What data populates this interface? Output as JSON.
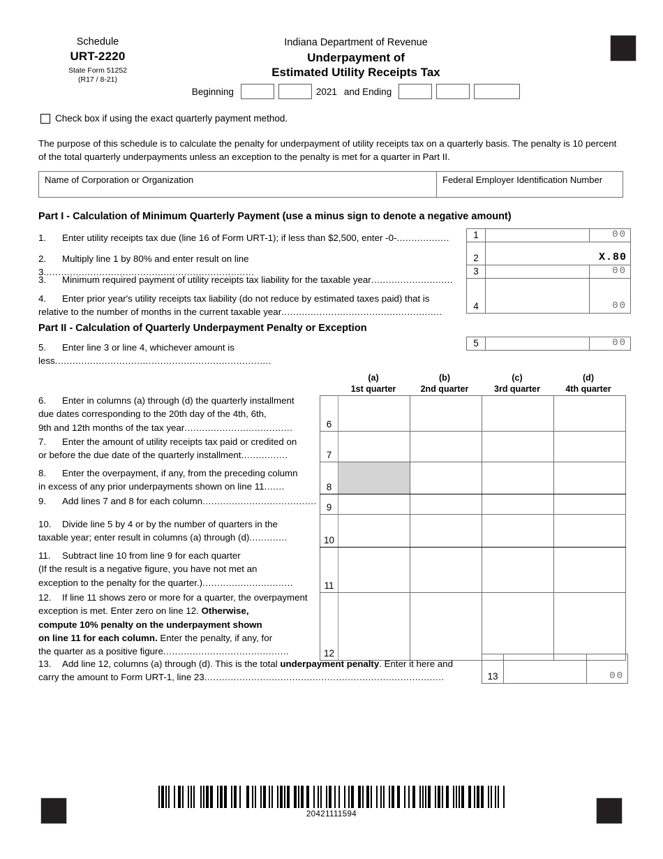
{
  "header": {
    "schedule_label": "Schedule",
    "form_number": "URT-2220",
    "state_form": "State Form 51252",
    "revision": "(R17 / 8-21)",
    "agency": "Indiana Department of Revenue",
    "title_line1": "Underpayment of",
    "title_line2": "Estimated Utility Receipts Tax"
  },
  "period": {
    "beginning_label": "Beginning",
    "year": "2021",
    "ending_label": "and Ending",
    "beginning_month": "",
    "beginning_day": "",
    "ending_month": "",
    "ending_day": "",
    "ending_year": ""
  },
  "exact_method": {
    "label": "Check box if using the exact quarterly payment method.",
    "checked": false
  },
  "purpose": "The purpose of this schedule is to calculate the penalty for underpayment of utility receipts tax on a quarterly basis. The penalty is 10 percent of the total quarterly underpayments unless an exception to the penalty is met for a quarter in Part II.",
  "taxpayer": {
    "name_label": "Name of Corporation or Organization",
    "name_value": "",
    "fein_label": "Federal Employer Identification Number",
    "fein_value": ""
  },
  "part1": {
    "heading": "Part I - Calculation of Minimum Quarterly Payment (use a minus sign to denote a negative amount)",
    "lines": [
      {
        "no": "1.",
        "box_no": "1",
        "text": "Enter utility receipts tax due (line 16 of Form URT-1); if less than $2,500, enter -0-",
        "leader": "..................",
        "value": "",
        "cents": "00"
      },
      {
        "no": "2.",
        "box_no": "2",
        "text": "Multiply line 1 by 80% and enter result on line 3",
        "leader": "........................................................................",
        "value": "",
        "cents": "X.80"
      },
      {
        "no": "3.",
        "box_no": "3",
        "text": "Minimum required payment of utility receipts tax liability for the taxable year",
        "leader": "............................",
        "value": "",
        "cents": "00"
      },
      {
        "no": "4.",
        "box_no": "4",
        "text_line1": "Enter prior year's utility receipts tax liability (do not reduce by estimated taxes paid) that is",
        "text_line2": "relative to the number of months in the current taxable year",
        "leader": ".......................................................",
        "value": "",
        "cents": "00"
      }
    ]
  },
  "part2": {
    "heading": "Part II - Calculation of Quarterly Underpayment Penalty or Exception",
    "line5": {
      "no": "5.",
      "box_no": "5",
      "text": "Enter line 3 or line 4, whichever amount is less",
      "leader": "..........................................................................",
      "value": "",
      "cents": "00"
    },
    "column_headers": [
      {
        "letter": "(a)",
        "label": "1st quarter"
      },
      {
        "letter": "(b)",
        "label": "2nd quarter"
      },
      {
        "letter": "(c)",
        "label": "3rd quarter"
      },
      {
        "letter": "(d)",
        "label": "4th quarter"
      }
    ],
    "grid_lines": [
      {
        "no": "6.",
        "box_no": "6",
        "text_line1": "Enter in columns (a) through (d) the quarterly installment",
        "text_line2": "due dates corresponding to the 20th day of the 4th, 6th,",
        "text_line3": "9th and 12th months of the tax year",
        "leader": ".....................................",
        "cells": [
          "",
          "",
          "",
          ""
        ]
      },
      {
        "no": "7.",
        "box_no": "7",
        "text_line1": "Enter the amount of utility receipts tax paid or credited on",
        "text_line2": "or before the due date of the quarterly installment",
        "leader": "................",
        "cells": [
          "",
          "",
          "",
          ""
        ]
      },
      {
        "no": "8.",
        "box_no": "8",
        "text_line1": "Enter the overpayment, if any, from the preceding column",
        "text_line2": "in excess of any prior underpayments shown on line 11",
        "leader": ".......",
        "cells": [
          "",
          "",
          "",
          ""
        ],
        "shaded_columns": [
          0
        ]
      },
      {
        "no": "9.",
        "box_no": "9",
        "text_line1": "Add lines 7 and 8 for each column",
        "leader": ".......................................",
        "cells": [
          "",
          "",
          "",
          ""
        ]
      },
      {
        "no": "10.",
        "box_no": "10",
        "text_line1": "Divide line 5 by 4 or by the number of quarters in the",
        "text_line2": "taxable year; enter result in columns (a) through (d)",
        "leader": ".............",
        "cells": [
          "",
          "",
          "",
          ""
        ]
      },
      {
        "no": "11.",
        "box_no": "11",
        "text_line1": "Subtract line 10 from line 9 for each quarter",
        "text_line2": "(If the result is a negative figure, you have not met an",
        "text_line3": "exception to the penalty for the quarter.)",
        "leader": "...............................",
        "cells": [
          "",
          "",
          "",
          ""
        ]
      },
      {
        "no": "12.",
        "box_no": "12",
        "text_part1": "If line 11 shows zero or more for a quarter, the overpayment",
        "text_part2": "exception is met. Enter zero on line 12. ",
        "text_bold1": "Otherwise,",
        "text_bold2": "compute 10% penalty on the underpayment shown",
        "text_bold3": "on line 11 for each column.",
        "text_part3": "  Enter the penalty, if any, for",
        "text_part4": "the quarter as a positive figure",
        "leader": "...........................................",
        "cells": [
          "",
          "",
          "",
          ""
        ]
      }
    ],
    "line13": {
      "no": "13.",
      "box_no": "13",
      "text_part1": "Add line 12, columns (a) through (d). This is the total ",
      "text_bold": "underpayment penalty",
      "text_part2": ". Enter it here and",
      "text_line2": "carry the amount to Form URT-1, line 23",
      "leader": "..................................................................................",
      "value": "",
      "cents": "00"
    }
  },
  "footer": {
    "barcode_number": "20421111594"
  },
  "colors": {
    "rule": "#6d6e71",
    "shade": "#d4d4d4",
    "cents_text": "#6d6e71",
    "reg_mark": "#231f20"
  }
}
